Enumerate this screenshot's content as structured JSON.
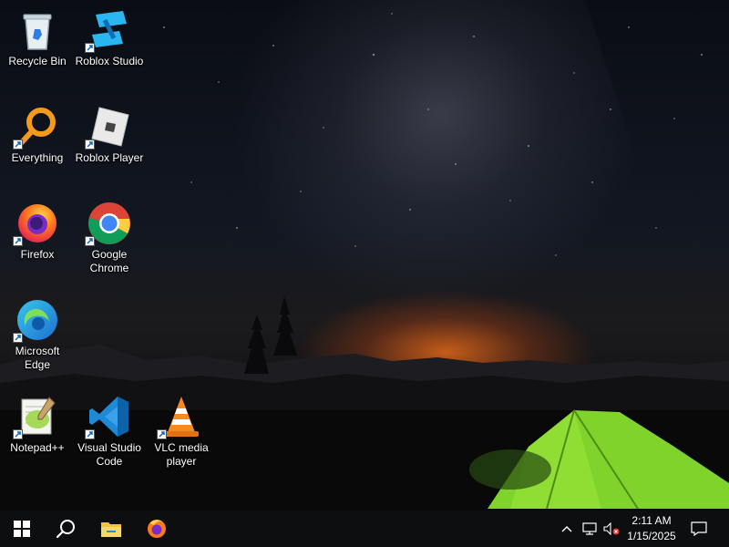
{
  "desktop": {
    "icons": [
      {
        "label": "Recycle Bin"
      },
      {
        "label": "Roblox Studio"
      },
      {
        "label": "Everything"
      },
      {
        "label": "Roblox Player"
      },
      {
        "label": "Firefox"
      },
      {
        "label": "Google Chrome"
      },
      {
        "label": "Microsoft Edge"
      },
      {
        "label": "Notepad++"
      },
      {
        "label": "Visual Studio Code"
      },
      {
        "label": "VLC media player"
      }
    ]
  },
  "taskbar": {
    "start_icon": "windows-logo-icon",
    "search_icon": "search-icon",
    "pinned": [
      {
        "icon": "file-explorer-icon"
      },
      {
        "icon": "firefox-icon"
      }
    ],
    "tray": {
      "chevron_icon": "chevron-up-icon",
      "network_icon": "network-icon",
      "volume_icon": "volume-muted-icon",
      "notifications_icon": "action-center-icon"
    },
    "clock": {
      "time": "2:11 AM",
      "date": "1/15/2025"
    }
  },
  "colors": {
    "taskbar": "#0d0e10",
    "tent": "#7fd32a",
    "glow": "#ff7319"
  }
}
